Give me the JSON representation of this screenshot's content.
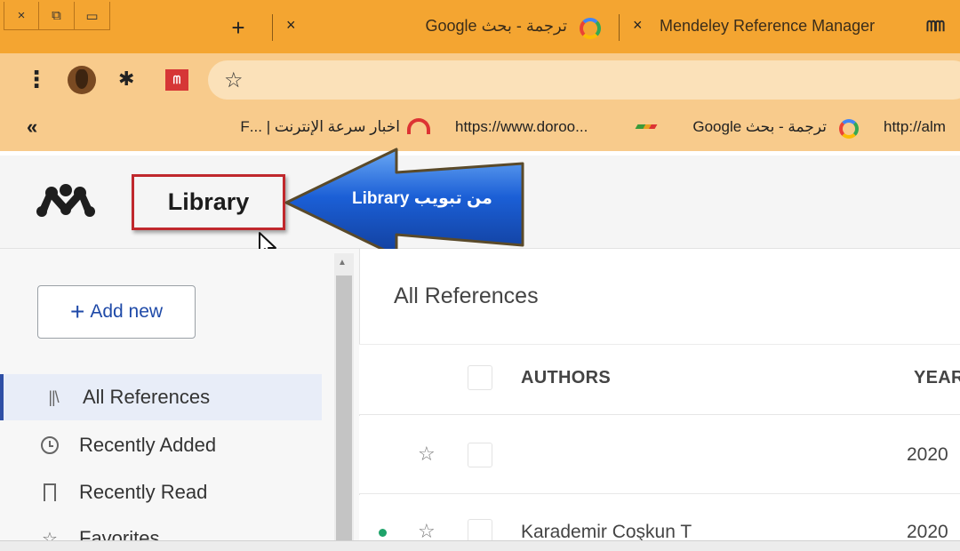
{
  "browser": {
    "tabs": [
      {
        "title": "ترجمة - بحث Google"
      },
      {
        "title": "Mendeley Reference Manager"
      }
    ],
    "new_tab": "+",
    "tab_close": "×"
  },
  "window_controls": {
    "close": "×",
    "restore": "⧉",
    "minimize": "▭"
  },
  "toolbar": {
    "menu": "⋮",
    "extension_badge": "ᗰ"
  },
  "bookmarks": {
    "overflow": "«",
    "items": [
      {
        "label": "اخبار سرعة الإنترنت | ...F"
      },
      {
        "label": "https://www.doroo..."
      },
      {
        "label": "ترجمة - بحث Google"
      },
      {
        "label": "http://alm"
      }
    ]
  },
  "app": {
    "library_tab": "Library",
    "callout": "من تبويب  Library",
    "sidebar": {
      "add_new": "Add new",
      "items": [
        {
          "label": "All References",
          "icon": "library-icon",
          "active": true
        },
        {
          "label": "Recently Added",
          "icon": "clock-icon"
        },
        {
          "label": "Recently Read",
          "icon": "bookmark-icon"
        },
        {
          "label": "Favorites",
          "icon": "star-icon"
        }
      ]
    },
    "main": {
      "title": "All References",
      "columns": [
        "AUTHORS",
        "YEAR"
      ],
      "rows": [
        {
          "authors": "",
          "year": "2020",
          "unread": false
        },
        {
          "authors": "Karademir Coşkun T",
          "year": "2020",
          "unread": true
        }
      ]
    }
  },
  "colors": {
    "tabstrip": "#f4a531",
    "toolbar": "#f8cb8c",
    "callout_blue": "#1b5fd6",
    "highlight_red": "#c0282d",
    "active_nav": "#2e4fa6"
  }
}
